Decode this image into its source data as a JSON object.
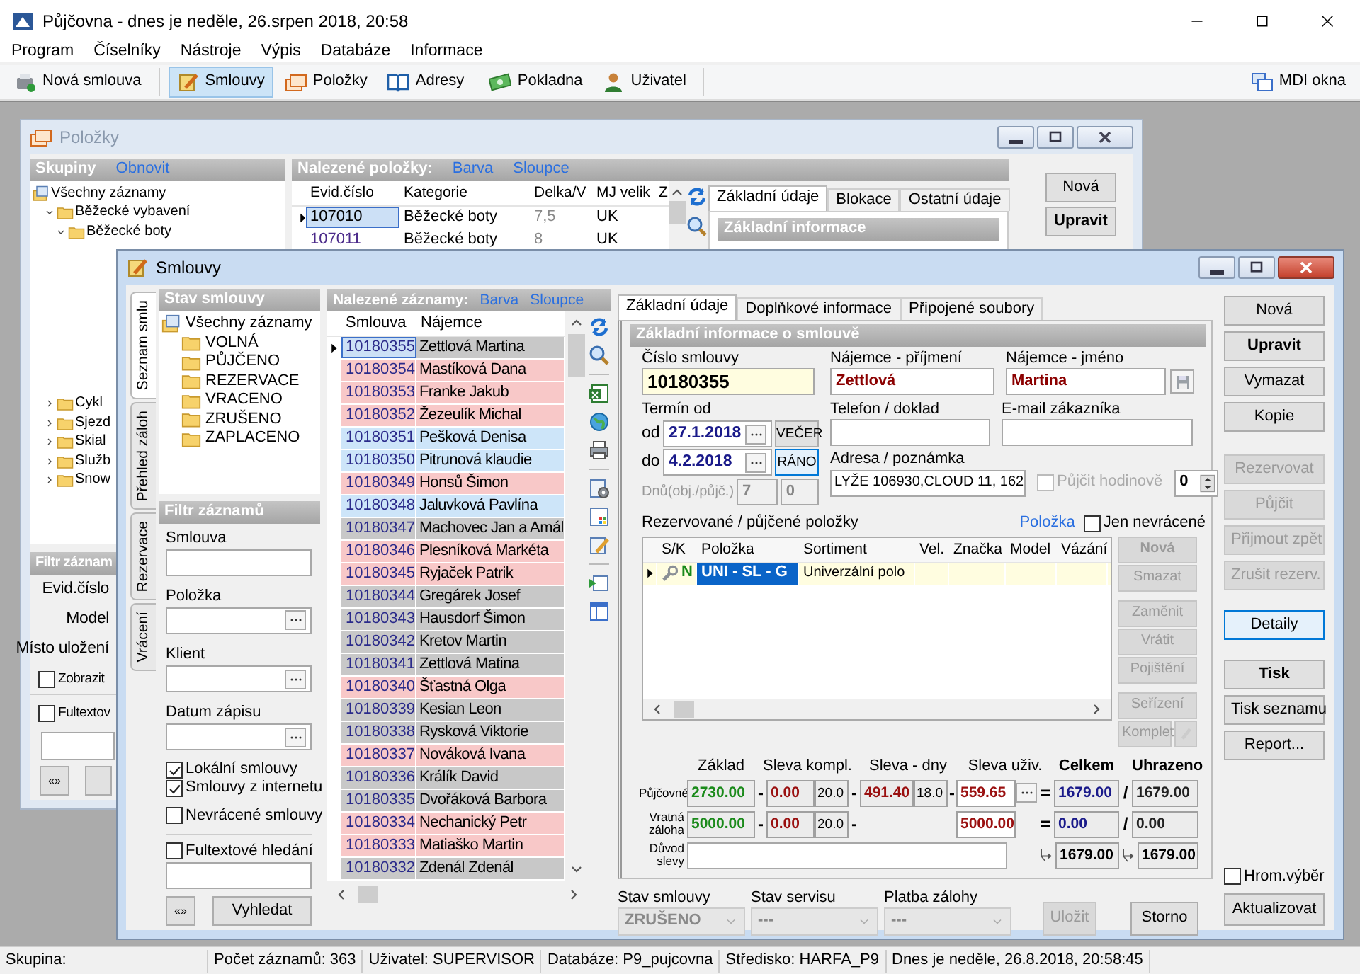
{
  "window": {
    "title": "Půjčovna - dnes je neděle, 26.srpen 2018, 20:58"
  },
  "menu": [
    "Program",
    "Číselníky",
    "Nástroje",
    "Výpis",
    "Databáze",
    "Informace"
  ],
  "toolbar": [
    {
      "label": "Nová smlouva",
      "selected": false
    },
    {
      "label": "Smlouvy",
      "selected": true
    },
    {
      "label": "Položky",
      "selected": false
    },
    {
      "label": "Adresy",
      "selected": false
    },
    {
      "label": "Pokladna",
      "selected": false
    },
    {
      "label": "Uživatel",
      "selected": false
    }
  ],
  "mdi_button": "MDI okna",
  "items_window": {
    "title": "Položky",
    "groups": {
      "title": "Skupiny",
      "link": "Obnovit",
      "tree": [
        {
          "label": "Všechny záznamy",
          "children": [
            {
              "label": "Běžecké vybavení",
              "expanded": true,
              "children": [
                {
                  "label": "Běžecké boty",
                  "expanded": true
                }
              ]
            },
            {
              "label": "Cykl",
              "expanded": false
            },
            {
              "label": "Sjezd",
              "expanded": false
            },
            {
              "label": "Skial",
              "expanded": false
            },
            {
              "label": "Služb",
              "expanded": false
            },
            {
              "label": "Snow",
              "expanded": false
            }
          ]
        }
      ]
    },
    "filter": {
      "title": "Filtr záznam",
      "fields": [
        "Evid.číslo",
        "Model",
        "Místo uložení"
      ],
      "checks": [
        {
          "label": "Zobrazit",
          "checked": false
        },
        {
          "label": "Fultextov",
          "checked": false
        }
      ],
      "button": "«»"
    },
    "grid": {
      "title": "Nalezené položky:",
      "links": [
        "Barva",
        "Sloupce"
      ],
      "columns": [
        "Evid.číslo",
        "Kategorie",
        "Delka/V",
        "MJ velik",
        "Z"
      ],
      "rows": [
        {
          "cells": [
            "107010",
            "Běžecké boty",
            "7,5",
            "UK"
          ],
          "selected": true
        },
        {
          "cells": [
            "107011",
            "Běžecké boty",
            "8",
            "UK"
          ],
          "selected": false
        }
      ]
    },
    "tabs": [
      {
        "label": "Základní údaje",
        "selected": true
      },
      {
        "label": "Blokace",
        "selected": false
      },
      {
        "label": "Ostatní údaje",
        "selected": false
      }
    ],
    "section": "Základní informace",
    "buttons": [
      {
        "label": "Nová",
        "default": false
      },
      {
        "label": "Upravit",
        "default": true
      }
    ]
  },
  "contracts_window": {
    "title": "Smlouvy",
    "side_tabs": [
      {
        "label": "Seznam smlu",
        "selected": true
      },
      {
        "label": "Přehled záloh",
        "selected": false
      },
      {
        "label": "Rezervace",
        "selected": false
      },
      {
        "label": "Vrácení",
        "selected": false
      }
    ],
    "status_tree": {
      "title": "Stav smlouvy",
      "tree": [
        {
          "label": "Všechny záznamy",
          "children": [
            {
              "label": "VOLNÁ"
            },
            {
              "label": "PŮJČENO"
            },
            {
              "label": "REZERVACE"
            },
            {
              "label": "VRACENO"
            },
            {
              "label": "ZRUŠENO"
            },
            {
              "label": "ZAPLACENO"
            }
          ]
        }
      ]
    },
    "filter": {
      "title": "Filtr záznamů",
      "fields": [
        {
          "label": "Smlouva",
          "kind": "text"
        },
        {
          "label": "Položka",
          "kind": "picker"
        },
        {
          "label": "Klient",
          "kind": "picker"
        },
        {
          "label": "Datum zápisu",
          "kind": "picker"
        }
      ],
      "checks": [
        {
          "label": "Lokální smlouvy",
          "checked": true
        },
        {
          "label": "Smlouvy z internetu",
          "checked": true
        },
        {
          "label": "Nevrácené smlouvy",
          "checked": false
        }
      ],
      "fulltext": {
        "label": "Fultextové hledání",
        "checked": false
      },
      "buttons": [
        "«»",
        "Vyhledat"
      ]
    },
    "grid": {
      "title": "Nalezené záznamy:",
      "links": [
        "Barva",
        "Sloupce"
      ],
      "columns": [
        "Smlouva",
        "Nájemce"
      ],
      "rows": [
        {
          "contract": "10180355",
          "tenant": "Zettlová Martina",
          "color": "#c8c8c8",
          "selected": true
        },
        {
          "contract": "10180354",
          "tenant": "Mastíková Dana",
          "color": "#f8c8c8",
          "selected": false
        },
        {
          "contract": "10180353",
          "tenant": "Franke Jakub",
          "color": "#f8c8c8",
          "selected": false
        },
        {
          "contract": "10180352",
          "tenant": "Žezeulík Michal",
          "color": "#f8c8c8",
          "selected": false
        },
        {
          "contract": "10180351",
          "tenant": "Pešková Denisa",
          "color": "#cde5f9",
          "selected": false
        },
        {
          "contract": "10180350",
          "tenant": "Pitrunová klaudie",
          "color": "#cde5f9",
          "selected": false
        },
        {
          "contract": "10180349",
          "tenant": "Honsů Šimon",
          "color": "#f8c8c8",
          "selected": false
        },
        {
          "contract": "10180348",
          "tenant": "Jaluvková Pavlína",
          "color": "#cde5f9",
          "selected": false
        },
        {
          "contract": "10180347",
          "tenant": "Machovec  Jan a Amál",
          "color": "#c8c8c8",
          "selected": false
        },
        {
          "contract": "10180346",
          "tenant": "Plesníková Markéta",
          "color": "#f8c8c8",
          "selected": false
        },
        {
          "contract": "10180345",
          "tenant": "Ryjaček Patrik",
          "color": "#f8c8c8",
          "selected": false
        },
        {
          "contract": "10180344",
          "tenant": "Gregárek Josef",
          "color": "#c8c8c8",
          "selected": false
        },
        {
          "contract": "10180343",
          "tenant": "Hausdorf Šimon",
          "color": "#c8c8c8",
          "selected": false
        },
        {
          "contract": "10180342",
          "tenant": "Kretov Martin",
          "color": "#c8c8c8",
          "selected": false
        },
        {
          "contract": "10180341",
          "tenant": "Zettlová Matina",
          "color": "#c8c8c8",
          "selected": false
        },
        {
          "contract": "10180340",
          "tenant": "Šťastná Olga",
          "color": "#f8c8c8",
          "selected": false
        },
        {
          "contract": "10180339",
          "tenant": "Kesian Leon",
          "color": "#c8c8c8",
          "selected": false
        },
        {
          "contract": "10180338",
          "tenant": "Rysková Viktorie",
          "color": "#c8c8c8",
          "selected": false
        },
        {
          "contract": "10180337",
          "tenant": "Nováková Ivana",
          "color": "#f8c8c8",
          "selected": false
        },
        {
          "contract": "10180336",
          "tenant": "Králík David",
          "color": "#c8c8c8",
          "selected": false
        },
        {
          "contract": "10180335",
          "tenant": "Dvořáková Barbora",
          "color": "#c8c8c8",
          "selected": false
        },
        {
          "contract": "10180334",
          "tenant": "Nechanický Petr",
          "color": "#f8c8c8",
          "selected": false
        },
        {
          "contract": "10180333",
          "tenant": "Matiaško Martin",
          "color": "#f8c8c8",
          "selected": false
        },
        {
          "contract": "10180332",
          "tenant": "Zdenál Zdenál",
          "color": "#c8c8c8",
          "selected": false
        }
      ]
    },
    "detail_tabs": [
      {
        "label": "Základní údaje",
        "selected": true
      },
      {
        "label": "Doplňkové informace",
        "selected": false
      },
      {
        "label": "Připojené soubory",
        "selected": false
      }
    ],
    "detail": {
      "title": "Základní informace o smlouvě",
      "contract_no": {
        "label": "Číslo smlouvy",
        "value": "10180355"
      },
      "surname": {
        "label": "Nájemce - příjmení",
        "value": "Zettlová"
      },
      "first_name": {
        "label": "Nájemce - jméno",
        "value": "Martina"
      },
      "term": {
        "label": "Termín od",
        "from": {
          "label": "od",
          "value": "27.1.2018",
          "slot": "VEČER",
          "selected": false
        },
        "to": {
          "label": "do",
          "value": "4.2.2018",
          "slot": "RÁNO",
          "selected": true
        },
        "days_label": "Dnů(obj./půjč.)",
        "days": [
          "7",
          "0"
        ]
      },
      "phone": {
        "label": "Telefon / doklad"
      },
      "email": {
        "label": "E-mail zákazníka"
      },
      "address": {
        "label": "Adresa / poznámka",
        "value": "LYŽE 106930,CLOUD 11, 162"
      },
      "hourly": {
        "label": "Půjčit hodinově",
        "checked": false,
        "disabled": true,
        "value": "0"
      },
      "items": {
        "title": "Rezervované / půjčené položky",
        "link": "Položka",
        "only_open": {
          "label": "Jen nevrácené",
          "checked": false
        },
        "columns": [
          "S/K",
          "Položka",
          "Sortiment",
          "Vel.",
          "Značka",
          "Model",
          "Vázání"
        ],
        "rows": [
          {
            "flag": "N",
            "item": "UNI - SL - G",
            "assortment": "Univerzální polo",
            "selected": true
          }
        ],
        "buttons": [
          {
            "label": "Nová",
            "disabled": true
          },
          {
            "label": "Smazat",
            "disabled": true
          },
          {
            "label": "Zaměnit",
            "disabled": true
          },
          {
            "label": "Vrátit",
            "disabled": true
          },
          {
            "label": "Pojištění",
            "disabled": true
          },
          {
            "label": "Seřízení",
            "disabled": true
          },
          {
            "label": "Komplet",
            "disabled": true
          }
        ]
      },
      "money": {
        "headers": [
          "Základ",
          "Sleva kompl.",
          "Sleva - dny",
          "Sleva uživ.",
          "Celkem",
          "Uhrazeno"
        ],
        "rows": [
          {
            "label": "Půjčovné",
            "base": "2730.00",
            "minus_1": "-",
            "discount": "0.00",
            "discount_pct": "20.0",
            "minus_2": "-",
            "day_discount": "491.40",
            "day_pct": "18.0",
            "minus_3": "-",
            "user_discount": "559.65",
            "equals": "=",
            "total": "1679.00",
            "slash": "/",
            "paid": "1679.00"
          },
          {
            "label": "Vratná záloha",
            "base": "5000.00",
            "minus_1": "-",
            "discount": "0.00",
            "discount_pct": "20.0",
            "minus_2": "-",
            "user_discount": "5000.00",
            "equals": "=",
            "total": "0.00",
            "slash": "/",
            "paid": "0.00"
          }
        ],
        "reason_label": "Důvod slevy",
        "sums": [
          "1679.00",
          "1679.00"
        ]
      }
    },
    "footer": {
      "fields": [
        {
          "label": "Stav smlouvy",
          "value": "ZRUŠENO"
        },
        {
          "label": "Stav servisu",
          "value": "---"
        },
        {
          "label": "Platba zálohy",
          "value": "---"
        }
      ],
      "buttons": [
        {
          "label": "Uložit",
          "disabled": true
        },
        {
          "label": "Storno",
          "disabled": false
        }
      ]
    },
    "action_groups": [
      [
        {
          "label": "Nová",
          "disabled": false,
          "default": false,
          "focused": false
        },
        {
          "label": "Upravit",
          "disabled": false,
          "default": true,
          "focused": false
        },
        {
          "label": "Vymazat",
          "disabled": false,
          "default": false,
          "focused": false
        },
        {
          "label": "Kopie",
          "disabled": false,
          "default": false,
          "focused": false
        }
      ],
      [
        {
          "label": "Rezervovat",
          "disabled": true,
          "default": false,
          "focused": false
        },
        {
          "label": "Půjčit",
          "disabled": true,
          "default": false,
          "focused": false
        },
        {
          "label": "Přijmout zpět",
          "disabled": true,
          "default": false,
          "focused": false
        },
        {
          "label": "Zrušit rezerv.",
          "disabled": true,
          "default": false,
          "focused": false
        }
      ],
      [
        {
          "label": "Detaily",
          "disabled": false,
          "default": false,
          "focused": true
        }
      ],
      [
        {
          "label": "Tisk",
          "disabled": false,
          "default": true,
          "focused": false
        },
        {
          "label": "Tisk seznamu",
          "disabled": false,
          "default": false,
          "focused": false
        },
        {
          "label": "Report...",
          "disabled": false,
          "default": false,
          "focused": false
        }
      ]
    ],
    "multi_select": {
      "label": "Hrom.výběr",
      "checked": false
    },
    "refresh_button": "Aktualizovat"
  },
  "status_bar": [
    "Skupina:",
    "Počet záznamů: 363",
    "Uživatel: SUPERVISOR",
    "Databáze: P9_pujcovna",
    "Středisko: HARFA_P9",
    "Dnes je neděle, 26.8.2018, 20:58:45"
  ]
}
